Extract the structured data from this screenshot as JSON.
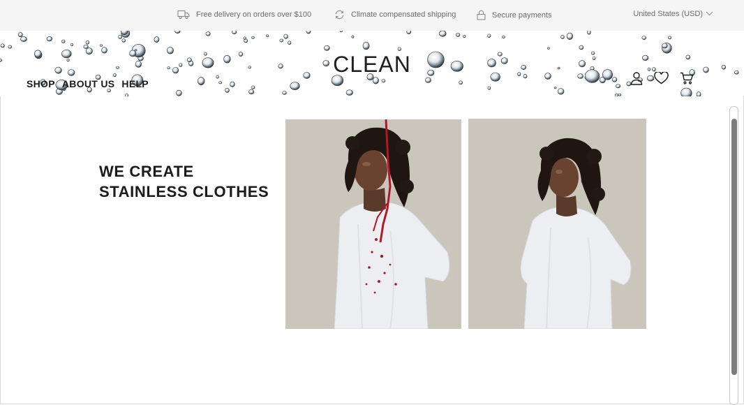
{
  "topbar": {
    "promos": [
      {
        "icon": "truck-icon",
        "text": "Free delivery on orders over $100"
      },
      {
        "icon": "refresh-icon",
        "text": "Climate compensated shipping"
      },
      {
        "icon": "lock-icon",
        "text": "Secure payments"
      }
    ],
    "currency": "United States (USD)"
  },
  "header": {
    "logo": "CLEAN",
    "nav": [
      "SHOP",
      "ABOUT US",
      "HELP"
    ],
    "icons": [
      "account-icon",
      "wishlist-heart-icon",
      "cart-icon"
    ]
  },
  "hero": {
    "headline_line1": "WE CREATE",
    "headline_line2": "STAINLESS CLOTHES",
    "images": [
      "model-white-tshirt-wine-splash",
      "model-white-tshirt-clean"
    ]
  },
  "colors": {
    "topbar_bg": "#f5f5f5",
    "photo_bg": "#cbc6bb",
    "text": "#1a1a1a",
    "stain": "#b0182a"
  }
}
